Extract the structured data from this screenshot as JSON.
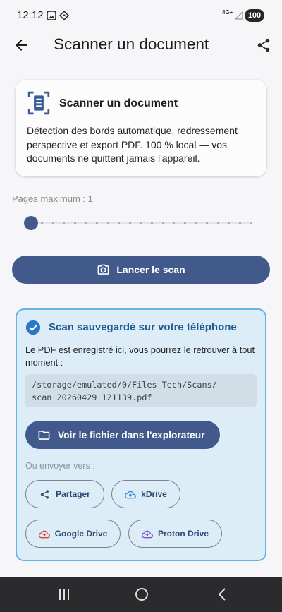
{
  "status_bar": {
    "time": "12:12",
    "network": "4G+",
    "battery": "100",
    "icons": [
      "gallery-icon",
      "diamond-icon",
      "signal-icon"
    ]
  },
  "app_bar": {
    "title": "Scanner un document",
    "back_icon": "arrow-back-icon",
    "share_icon": "share-icon"
  },
  "intro_card": {
    "icon": "document-scanner-icon",
    "title": "Scanner un document",
    "description": "Détection des bords automatique, redressement perspective et export PDF. 100 % local — vos documents ne quittent jamais l'appareil."
  },
  "pages_slider": {
    "label": "Pages maximum : 1",
    "level": 0
  },
  "scan_button": {
    "label": "Lancer le scan",
    "icon": "camera-icon"
  },
  "result": {
    "icon": "check-circle-icon",
    "title": "Scan sauvegardé sur votre téléphone",
    "message": "Le PDF est enregistré ici, vous pourrez le retrouver à tout moment :",
    "file_path": "/storage/emulated/0/Files Tech/Scans/scan_20260429_121139.pdf",
    "open_button": {
      "label": "Voir le fichier dans l'explorateur",
      "icon": "folder-icon"
    },
    "send_label": "Ou envoyer vers :",
    "targets": [
      {
        "label": "Partager",
        "icon": "share-icon",
        "color": "#34506f"
      },
      {
        "label": "kDrive",
        "icon": "cloud-upload-icon",
        "color": "#2d8be0"
      },
      {
        "label": "Google Drive",
        "icon": "cloud-upload-icon",
        "color": "#d9453b"
      },
      {
        "label": "Proton Drive",
        "icon": "cloud-upload-icon",
        "color": "#7b52c9"
      }
    ]
  },
  "nav_bar": {
    "icons": [
      "recents-icon",
      "home-icon",
      "nav-back-icon"
    ]
  },
  "colors": {
    "primary": "#41598b",
    "accent": "#2b78c5",
    "success_title": "#1f5a92",
    "success_bg": "#dcedf7",
    "success_border": "#62b4e6",
    "icon_blue": "#3b5d96",
    "page_bg": "#f6f6f8"
  }
}
